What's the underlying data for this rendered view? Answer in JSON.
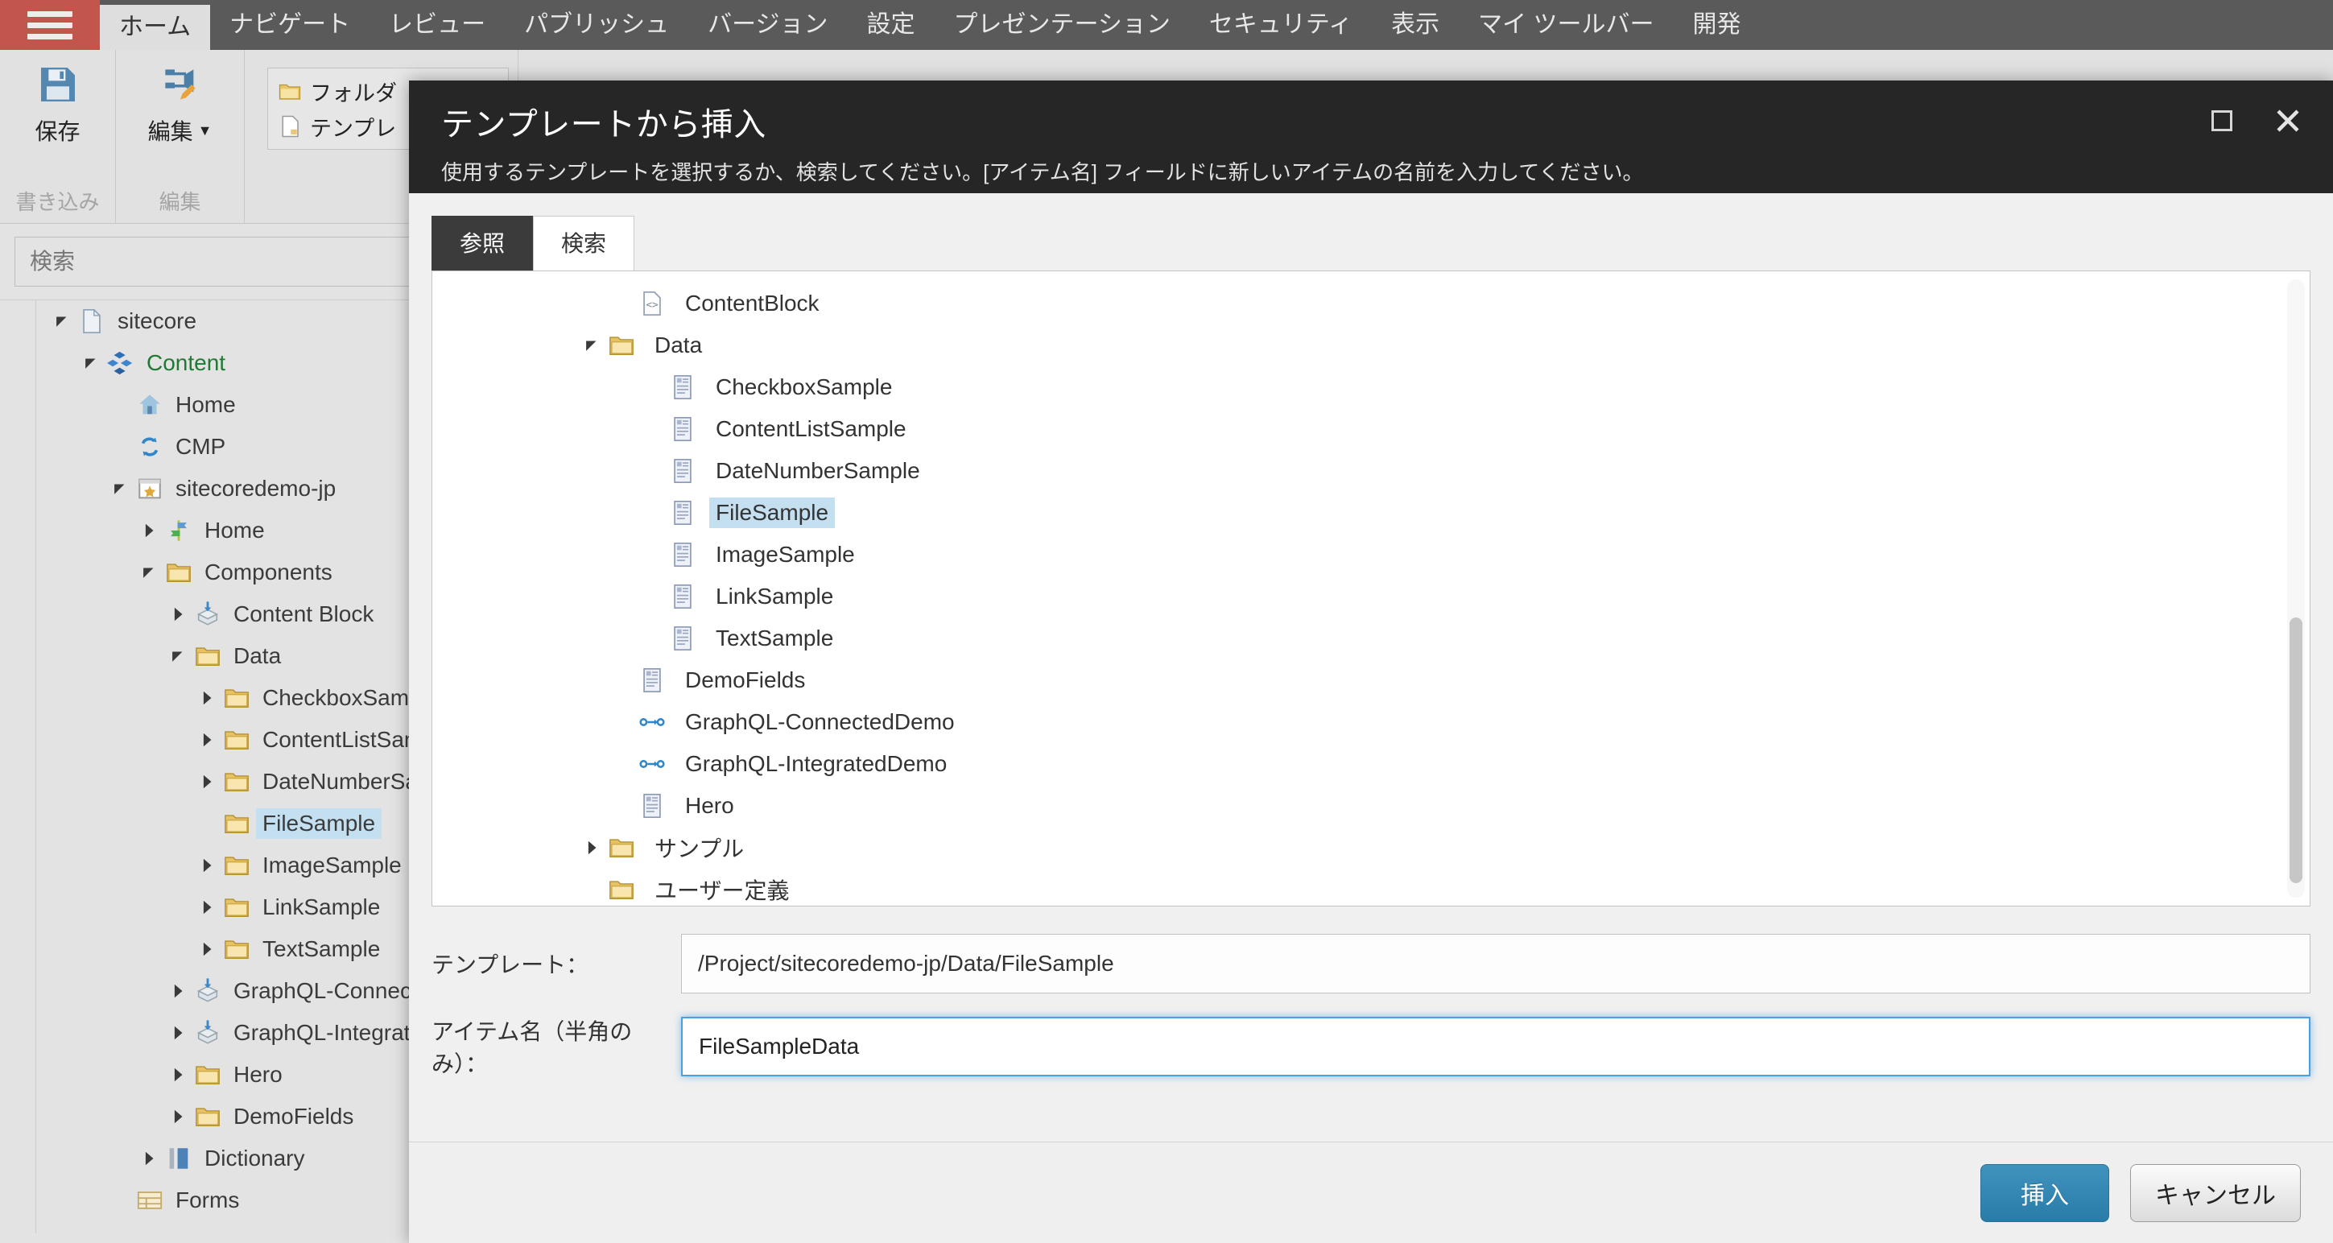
{
  "ribbon": {
    "menu_icon": "hamburger-icon",
    "tabs": [
      {
        "label": "ホーム",
        "active": true
      },
      {
        "label": "ナビゲート",
        "active": false
      },
      {
        "label": "レビュー",
        "active": false
      },
      {
        "label": "パブリッシュ",
        "active": false
      },
      {
        "label": "バージョン",
        "active": false
      },
      {
        "label": "設定",
        "active": false
      },
      {
        "label": "プレゼンテーション",
        "active": false
      },
      {
        "label": "セキュリティ",
        "active": false
      },
      {
        "label": "表示",
        "active": false
      },
      {
        "label": "マイ ツールバー",
        "active": false
      },
      {
        "label": "開発",
        "active": false
      }
    ]
  },
  "toolbar": {
    "save_label": "保存",
    "save_icon": "floppy-disk-icon",
    "save_group_caption": "書き込み",
    "edit_label": "編集",
    "edit_icon": "edit-pencil-icon",
    "edit_group_caption": "編集",
    "insert_folder_label": "フォルダ",
    "insert_folder_icon": "folder-icon",
    "insert_template_label": "テンプレ",
    "insert_template_icon": "page-icon"
  },
  "sidebar": {
    "search": {
      "placeholder": "検索",
      "value": "",
      "icon": "search-icon"
    },
    "tree": [
      {
        "label": "sitecore",
        "depth": 0,
        "caret": "down",
        "icon": "document-icon",
        "selected": false,
        "green": false
      },
      {
        "label": "Content",
        "depth": 1,
        "caret": "down",
        "icon": "cubes-icon",
        "selected": false,
        "green": true
      },
      {
        "label": "Home",
        "depth": 2,
        "caret": "none",
        "icon": "house-icon",
        "selected": false,
        "green": false
      },
      {
        "label": "CMP",
        "depth": 2,
        "caret": "none",
        "icon": "sync-icon",
        "selected": false,
        "green": false
      },
      {
        "label": "sitecoredemo-jp",
        "depth": 2,
        "caret": "down",
        "icon": "site-star-icon",
        "selected": false,
        "green": false
      },
      {
        "label": "Home",
        "depth": 3,
        "caret": "right",
        "icon": "signpost-icon",
        "selected": false,
        "green": false
      },
      {
        "label": "Components",
        "depth": 3,
        "caret": "down",
        "icon": "folder-icon",
        "selected": false,
        "green": false
      },
      {
        "label": "Content Block",
        "depth": 4,
        "caret": "right",
        "icon": "package-icon",
        "selected": false,
        "green": false
      },
      {
        "label": "Data",
        "depth": 4,
        "caret": "down",
        "icon": "folder-icon",
        "selected": false,
        "green": false
      },
      {
        "label": "CheckboxSample",
        "depth": 5,
        "caret": "right",
        "icon": "folder-icon",
        "selected": false,
        "green": false
      },
      {
        "label": "ContentListSample",
        "depth": 5,
        "caret": "right",
        "icon": "folder-icon",
        "selected": false,
        "green": false
      },
      {
        "label": "DateNumberSample",
        "depth": 5,
        "caret": "right",
        "icon": "folder-icon",
        "selected": false,
        "green": false
      },
      {
        "label": "FileSample",
        "depth": 5,
        "caret": "none",
        "icon": "folder-icon",
        "selected": true,
        "green": false
      },
      {
        "label": "ImageSample",
        "depth": 5,
        "caret": "right",
        "icon": "folder-icon",
        "selected": false,
        "green": false
      },
      {
        "label": "LinkSample",
        "depth": 5,
        "caret": "right",
        "icon": "folder-icon",
        "selected": false,
        "green": false
      },
      {
        "label": "TextSample",
        "depth": 5,
        "caret": "right",
        "icon": "folder-icon",
        "selected": false,
        "green": false
      },
      {
        "label": "GraphQL-ConnectedDe",
        "depth": 4,
        "caret": "right",
        "icon": "package-icon",
        "selected": false,
        "green": false
      },
      {
        "label": "GraphQL-IntegratedDe",
        "depth": 4,
        "caret": "right",
        "icon": "package-icon",
        "selected": false,
        "green": false
      },
      {
        "label": "Hero",
        "depth": 4,
        "caret": "right",
        "icon": "folder-icon",
        "selected": false,
        "green": false
      },
      {
        "label": "DemoFields",
        "depth": 4,
        "caret": "right",
        "icon": "folder-icon",
        "selected": false,
        "green": false
      },
      {
        "label": "Dictionary",
        "depth": 3,
        "caret": "right",
        "icon": "book-icon",
        "selected": false,
        "green": false
      },
      {
        "label": "Forms",
        "depth": 2,
        "caret": "none",
        "icon": "forms-icon",
        "selected": false,
        "green": false
      }
    ]
  },
  "dialog": {
    "title": "テンプレートから挿入",
    "subtitle": "使用するテンプレートを選択するか、検索してください。[アイテム名] フィールドに新しいアイテムの名前を入力してください。",
    "maximize_icon": "maximize-icon",
    "close_icon": "close-icon",
    "tabs": [
      {
        "label": "参照",
        "active": true
      },
      {
        "label": "検索",
        "active": false
      }
    ],
    "tree": [
      {
        "label": "ContentBlock",
        "depth": 1,
        "caret": "none",
        "icon": "code-page-icon",
        "selected": false
      },
      {
        "label": "Data",
        "depth": 0,
        "caret": "down",
        "icon": "folder-icon",
        "selected": false
      },
      {
        "label": "CheckboxSample",
        "depth": 2,
        "caret": "none",
        "icon": "template-icon",
        "selected": false
      },
      {
        "label": "ContentListSample",
        "depth": 2,
        "caret": "none",
        "icon": "template-icon",
        "selected": false
      },
      {
        "label": "DateNumberSample",
        "depth": 2,
        "caret": "none",
        "icon": "template-icon",
        "selected": false
      },
      {
        "label": "FileSample",
        "depth": 2,
        "caret": "none",
        "icon": "template-icon",
        "selected": true
      },
      {
        "label": "ImageSample",
        "depth": 2,
        "caret": "none",
        "icon": "template-icon",
        "selected": false
      },
      {
        "label": "LinkSample",
        "depth": 2,
        "caret": "none",
        "icon": "template-icon",
        "selected": false
      },
      {
        "label": "TextSample",
        "depth": 2,
        "caret": "none",
        "icon": "template-icon",
        "selected": false
      },
      {
        "label": "DemoFields",
        "depth": 1,
        "caret": "none",
        "icon": "template-icon",
        "selected": false
      },
      {
        "label": "GraphQL-ConnectedDemo",
        "depth": 1,
        "caret": "none",
        "icon": "link-nodes-icon",
        "selected": false
      },
      {
        "label": "GraphQL-IntegratedDemo",
        "depth": 1,
        "caret": "none",
        "icon": "link-nodes-icon",
        "selected": false
      },
      {
        "label": "Hero",
        "depth": 1,
        "caret": "none",
        "icon": "template-icon",
        "selected": false
      },
      {
        "label": "サンプル",
        "depth": 0,
        "caret": "right",
        "icon": "folder-icon",
        "selected": false
      },
      {
        "label": "ユーザー定義",
        "depth": 0,
        "caret": "none",
        "icon": "folder-icon",
        "selected": false
      }
    ],
    "form": {
      "template_label": "テンプレート：",
      "template_value": "/Project/sitecoredemo-jp/Data/FileSample",
      "itemname_label": "アイテム名（半角のみ）：",
      "itemname_value": "FileSampleData"
    },
    "footer": {
      "insert_label": "挿入",
      "cancel_label": "キャンセル"
    }
  },
  "colors": {
    "accent_red": "#c2564c",
    "header_gray": "#5a5a5a",
    "dialog_dark": "#262626",
    "selection_blue": "#c3dff0",
    "primary_button": "#2a7ca8",
    "focus_blue": "#4a9fe0"
  }
}
